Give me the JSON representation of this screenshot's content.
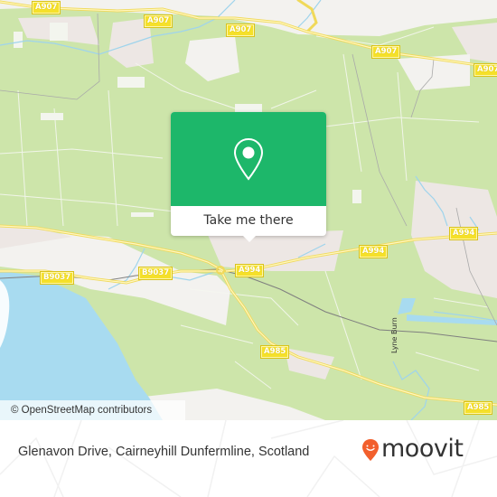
{
  "map": {
    "colors": {
      "land": "#cde5aa",
      "water": "#a8dbf0",
      "urban": "#ede7e4",
      "road_major": "#f5e02a",
      "rail": "#808080",
      "popup_accent": "#1db76a",
      "brand_pin": "#f25f2c"
    },
    "road_labels": [
      {
        "id": "a907-1",
        "text": "A907"
      },
      {
        "id": "a907-2",
        "text": "A907"
      },
      {
        "id": "a907-3",
        "text": "A907"
      },
      {
        "id": "a907-4",
        "text": "A907"
      },
      {
        "id": "a907-5",
        "text": "A907"
      },
      {
        "id": "b9037-1",
        "text": "B9037"
      },
      {
        "id": "b9037-2",
        "text": "B9037"
      },
      {
        "id": "a994-1",
        "text": "A994"
      },
      {
        "id": "a994-2",
        "text": "A994"
      },
      {
        "id": "a994-3",
        "text": "A994"
      },
      {
        "id": "a985-1",
        "text": "A985"
      },
      {
        "id": "a985-2",
        "text": "A985"
      }
    ],
    "water_labels": [
      {
        "id": "lyne-burn",
        "text": "Lyne Burn"
      }
    ],
    "attribution": "© OpenStreetMap contributors"
  },
  "popup": {
    "icon": "map-pin-icon",
    "button_label": "Take me there"
  },
  "footer": {
    "address": "Glenavon Drive, Cairneyhill Dunfermline, Scotland",
    "brand": "moovit",
    "brand_icon": "moovit-pin-logo-icon"
  }
}
